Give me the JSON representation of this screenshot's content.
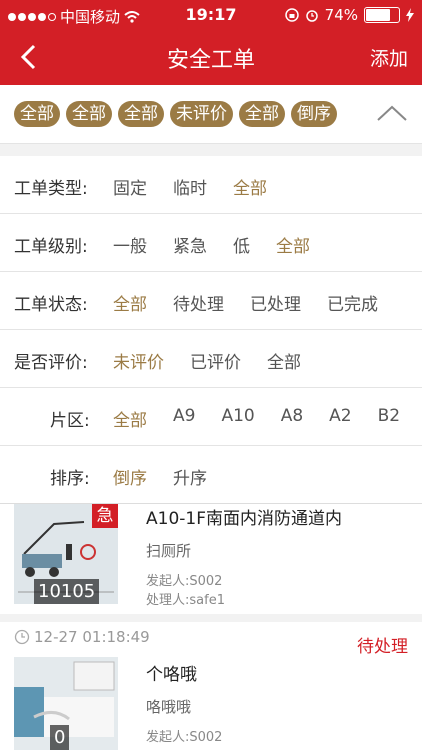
{
  "status_bar": {
    "carrier": "中国移动",
    "time": "19:17",
    "battery": "74%"
  },
  "nav": {
    "title": "安全工单",
    "add_label": "添加"
  },
  "active_tags": [
    "全部",
    "全部",
    "全部",
    "未评价",
    "全部",
    "倒序"
  ],
  "filters": [
    {
      "label": "工单类型:",
      "options": [
        "固定",
        "临时",
        "全部"
      ],
      "selected": 2
    },
    {
      "label": "工单级别:",
      "options": [
        "一般",
        "紧急",
        "低",
        "全部"
      ],
      "selected": 3
    },
    {
      "label": "工单状态:",
      "options": [
        "全部",
        "待处理",
        "已处理",
        "已完成"
      ],
      "selected": 0
    },
    {
      "label": "是否评价:",
      "options": [
        "未评价",
        "已评价",
        "全部"
      ],
      "selected": 0
    },
    {
      "label": "片区:",
      "options": [
        "全部",
        "A9",
        "A10",
        "A8",
        "A2",
        "B2"
      ],
      "selected": 0
    },
    {
      "label": "排序:",
      "options": [
        "倒序",
        "升序"
      ],
      "selected": 0
    }
  ],
  "orders": [
    {
      "urgent_badge": "急",
      "number": "10105",
      "title": "A10-1F南面内消防通道内",
      "subtitle": "扫厕所",
      "initiator": "发起人:S002",
      "handler": "处理人:safe1"
    },
    {
      "time": "12-27 01:18:49",
      "status": "待处理",
      "number": "0",
      "title": "个咯哦",
      "subtitle": "咯哦哦",
      "initiator": "发起人:S002"
    }
  ]
}
